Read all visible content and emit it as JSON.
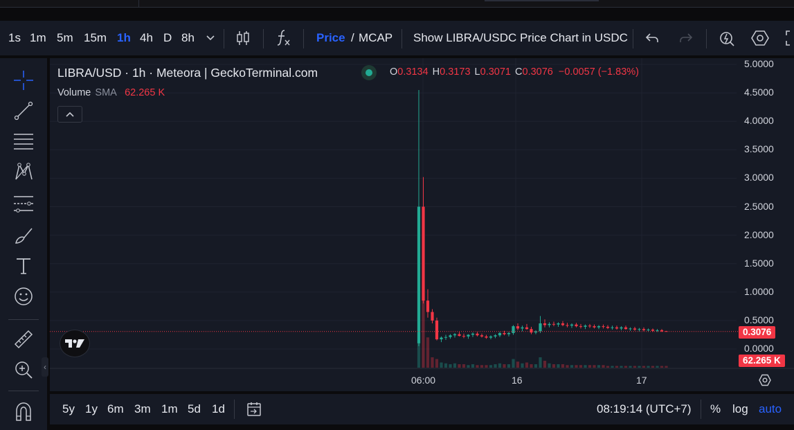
{
  "toolbar": {
    "intervals": [
      "1s",
      "1m",
      "5m",
      "15m",
      "1h",
      "4h",
      "D",
      "8h"
    ],
    "active_interval": "1h",
    "price_label": "Price",
    "slash": "/",
    "mcap_label": "MCAP",
    "show_chart_label": "Show LIBRA/USDC Price Chart in USDC"
  },
  "legend": {
    "title": "LIBRA/USD · 1h · Meteora | GeckoTerminal.com",
    "open_key": "O",
    "open": "0.3134",
    "high_key": "H",
    "high": "0.3173",
    "low_key": "L",
    "low": "0.3071",
    "close_key": "C",
    "close": "0.3076",
    "change": "−0.0057 (−1.83%)",
    "volume_label": "Volume",
    "volume_sma": "SMA",
    "volume_value": "62.265 K"
  },
  "price_axis": {
    "labels": [
      "5.0000",
      "4.5000",
      "4.0000",
      "3.5000",
      "3.0000",
      "2.5000",
      "2.0000",
      "1.5000",
      "1.0000",
      "0.5000",
      "0.0000"
    ],
    "current_price_tag": "0.3076",
    "volume_tag": "62.265 K"
  },
  "time_axis": {
    "labels": [
      "06:00",
      "16",
      "17"
    ]
  },
  "bottom": {
    "ranges": [
      "5y",
      "1y",
      "6m",
      "3m",
      "1m",
      "5d",
      "1d"
    ],
    "clock": "08:19:14 (UTC+7)",
    "percent": "%",
    "log": "log",
    "auto": "auto"
  },
  "colors": {
    "up": "#22ab94",
    "down": "#f23645",
    "background": "#161a25",
    "accent": "#2962ff"
  },
  "icons": [
    "candles-icon",
    "indicators-icon",
    "undo-icon",
    "redo-icon",
    "alert-icon",
    "settings-icon",
    "crosshair-icon",
    "trendline-icon",
    "fib-icon",
    "pattern-icon",
    "measure-lines-icon",
    "brush-icon",
    "text-icon",
    "emoji-icon",
    "ruler-icon",
    "zoom-icon",
    "magnet-icon",
    "calendar-icon"
  ],
  "chart_data": {
    "type": "candlestick",
    "title": "LIBRA/USD · 1h · Meteora | GeckoTerminal.com",
    "ylim": [
      0,
      5
    ],
    "x_ticks": [
      "06:00",
      "16",
      "17"
    ],
    "candles": [
      {
        "x": 0,
        "o": 0.1,
        "h": 4.55,
        "l": 0.05,
        "c": 2.5
      },
      {
        "x": 1,
        "o": 2.5,
        "h": 3.02,
        "l": 0.8,
        "c": 0.85
      },
      {
        "x": 2,
        "o": 0.85,
        "h": 1.05,
        "l": 0.55,
        "c": 0.65
      },
      {
        "x": 3,
        "o": 0.65,
        "h": 0.7,
        "l": 0.45,
        "c": 0.5
      },
      {
        "x": 4,
        "o": 0.5,
        "h": 0.55,
        "l": 0.15,
        "c": 0.17
      },
      {
        "x": 5,
        "o": 0.17,
        "h": 0.22,
        "l": 0.12,
        "c": 0.2
      },
      {
        "x": 6,
        "o": 0.2,
        "h": 0.25,
        "l": 0.16,
        "c": 0.21
      },
      {
        "x": 7,
        "o": 0.21,
        "h": 0.26,
        "l": 0.18,
        "c": 0.24
      },
      {
        "x": 8,
        "o": 0.24,
        "h": 0.28,
        "l": 0.2,
        "c": 0.26
      },
      {
        "x": 9,
        "o": 0.26,
        "h": 0.3,
        "l": 0.22,
        "c": 0.23
      },
      {
        "x": 10,
        "o": 0.23,
        "h": 0.27,
        "l": 0.19,
        "c": 0.22
      },
      {
        "x": 11,
        "o": 0.22,
        "h": 0.26,
        "l": 0.18,
        "c": 0.25
      },
      {
        "x": 12,
        "o": 0.25,
        "h": 0.29,
        "l": 0.21,
        "c": 0.27
      },
      {
        "x": 13,
        "o": 0.27,
        "h": 0.3,
        "l": 0.22,
        "c": 0.24
      },
      {
        "x": 14,
        "o": 0.24,
        "h": 0.27,
        "l": 0.2,
        "c": 0.22
      },
      {
        "x": 15,
        "o": 0.22,
        "h": 0.25,
        "l": 0.18,
        "c": 0.2
      },
      {
        "x": 16,
        "o": 0.2,
        "h": 0.24,
        "l": 0.17,
        "c": 0.22
      },
      {
        "x": 17,
        "o": 0.22,
        "h": 0.26,
        "l": 0.19,
        "c": 0.24
      },
      {
        "x": 18,
        "o": 0.24,
        "h": 0.3,
        "l": 0.21,
        "c": 0.28
      },
      {
        "x": 19,
        "o": 0.28,
        "h": 0.32,
        "l": 0.24,
        "c": 0.26
      },
      {
        "x": 20,
        "o": 0.26,
        "h": 0.3,
        "l": 0.22,
        "c": 0.28
      },
      {
        "x": 21,
        "o": 0.28,
        "h": 0.42,
        "l": 0.25,
        "c": 0.4
      },
      {
        "x": 22,
        "o": 0.4,
        "h": 0.45,
        "l": 0.33,
        "c": 0.36
      },
      {
        "x": 23,
        "o": 0.36,
        "h": 0.41,
        "l": 0.31,
        "c": 0.38
      },
      {
        "x": 24,
        "o": 0.38,
        "h": 0.44,
        "l": 0.34,
        "c": 0.35
      },
      {
        "x": 25,
        "o": 0.35,
        "h": 0.39,
        "l": 0.26,
        "c": 0.29
      },
      {
        "x": 26,
        "o": 0.29,
        "h": 0.33,
        "l": 0.26,
        "c": 0.31
      },
      {
        "x": 27,
        "o": 0.31,
        "h": 0.58,
        "l": 0.28,
        "c": 0.45
      },
      {
        "x": 28,
        "o": 0.45,
        "h": 0.52,
        "l": 0.38,
        "c": 0.42
      },
      {
        "x": 29,
        "o": 0.42,
        "h": 0.47,
        "l": 0.38,
        "c": 0.44
      },
      {
        "x": 30,
        "o": 0.44,
        "h": 0.48,
        "l": 0.4,
        "c": 0.43
      },
      {
        "x": 31,
        "o": 0.43,
        "h": 0.47,
        "l": 0.39,
        "c": 0.45
      },
      {
        "x": 32,
        "o": 0.45,
        "h": 0.49,
        "l": 0.4,
        "c": 0.42
      },
      {
        "x": 33,
        "o": 0.42,
        "h": 0.46,
        "l": 0.38,
        "c": 0.41
      },
      {
        "x": 34,
        "o": 0.41,
        "h": 0.45,
        "l": 0.37,
        "c": 0.43
      },
      {
        "x": 35,
        "o": 0.43,
        "h": 0.46,
        "l": 0.38,
        "c": 0.4
      },
      {
        "x": 36,
        "o": 0.4,
        "h": 0.44,
        "l": 0.36,
        "c": 0.39
      },
      {
        "x": 37,
        "o": 0.39,
        "h": 0.43,
        "l": 0.35,
        "c": 0.41
      },
      {
        "x": 38,
        "o": 0.41,
        "h": 0.44,
        "l": 0.37,
        "c": 0.4
      },
      {
        "x": 39,
        "o": 0.4,
        "h": 0.43,
        "l": 0.36,
        "c": 0.38
      },
      {
        "x": 40,
        "o": 0.38,
        "h": 0.42,
        "l": 0.35,
        "c": 0.4
      },
      {
        "x": 41,
        "o": 0.4,
        "h": 0.43,
        "l": 0.36,
        "c": 0.39
      },
      {
        "x": 42,
        "o": 0.39,
        "h": 0.42,
        "l": 0.35,
        "c": 0.37
      },
      {
        "x": 43,
        "o": 0.37,
        "h": 0.41,
        "l": 0.34,
        "c": 0.38
      },
      {
        "x": 44,
        "o": 0.38,
        "h": 0.41,
        "l": 0.34,
        "c": 0.36
      },
      {
        "x": 45,
        "o": 0.36,
        "h": 0.4,
        "l": 0.33,
        "c": 0.38
      },
      {
        "x": 46,
        "o": 0.38,
        "h": 0.41,
        "l": 0.34,
        "c": 0.35
      },
      {
        "x": 47,
        "o": 0.35,
        "h": 0.38,
        "l": 0.32,
        "c": 0.36
      },
      {
        "x": 48,
        "o": 0.36,
        "h": 0.39,
        "l": 0.32,
        "c": 0.34
      },
      {
        "x": 49,
        "o": 0.34,
        "h": 0.37,
        "l": 0.31,
        "c": 0.35
      },
      {
        "x": 50,
        "o": 0.35,
        "h": 0.38,
        "l": 0.31,
        "c": 0.33
      },
      {
        "x": 51,
        "o": 0.33,
        "h": 0.36,
        "l": 0.3,
        "c": 0.34
      },
      {
        "x": 52,
        "o": 0.34,
        "h": 0.36,
        "l": 0.3,
        "c": 0.32
      },
      {
        "x": 53,
        "o": 0.32,
        "h": 0.35,
        "l": 0.3,
        "c": 0.33
      },
      {
        "x": 54,
        "o": 0.33,
        "h": 0.35,
        "l": 0.3,
        "c": 0.31
      },
      {
        "x": 55,
        "o": 0.3134,
        "h": 0.3173,
        "l": 0.3071,
        "c": 0.3076
      }
    ],
    "volume": [
      0.9,
      1.0,
      0.35,
      0.12,
      0.1,
      0.06,
      0.05,
      0.04,
      0.05,
      0.04,
      0.04,
      0.03,
      0.04,
      0.03,
      0.03,
      0.03,
      0.03,
      0.04,
      0.05,
      0.04,
      0.04,
      0.1,
      0.07,
      0.05,
      0.06,
      0.04,
      0.04,
      0.12,
      0.08,
      0.05,
      0.04,
      0.04,
      0.04,
      0.03,
      0.03,
      0.03,
      0.03,
      0.03,
      0.03,
      0.03,
      0.03,
      0.03,
      0.02,
      0.02,
      0.02,
      0.02,
      0.02,
      0.02,
      0.02,
      0.02,
      0.02,
      0.02,
      0.02,
      0.02,
      0.02,
      0.02
    ],
    "current_price": 0.3076
  }
}
